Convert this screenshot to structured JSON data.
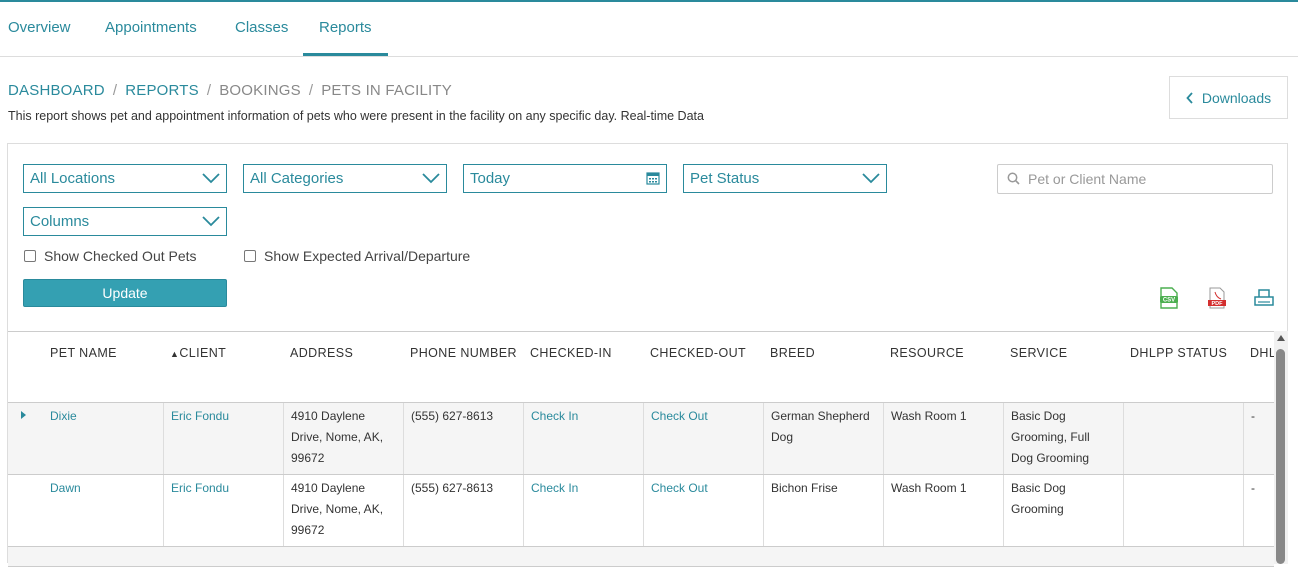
{
  "tabs": [
    {
      "label": "Overview"
    },
    {
      "label": "Appointments"
    },
    {
      "label": "Classes"
    },
    {
      "label": "Reports"
    }
  ],
  "breadcrumb": {
    "items": [
      "DASHBOARD",
      "REPORTS",
      "BOOKINGS",
      "PETS IN FACILITY"
    ],
    "separator": "/"
  },
  "description": "This report shows pet and appointment information of pets who were present in the facility on any specific day. Real-time Data",
  "downloads_label": "Downloads",
  "filters": {
    "locations": "All Locations",
    "categories": "All Categories",
    "date": "Today",
    "pet_status": "Pet Status",
    "columns": "Columns",
    "search_placeholder": "Pet or Client Name",
    "show_checked_out": "Show Checked Out Pets",
    "show_expected": "Show Expected Arrival/Departure",
    "update_label": "Update"
  },
  "export_icons": [
    "csv-icon",
    "pdf-icon",
    "print-icon"
  ],
  "export_labels": {
    "csv": "CSV",
    "pdf": "PDF"
  },
  "table": {
    "columns": [
      "PET NAME",
      "CLIENT",
      "ADDRESS",
      "PHONE NUMBER",
      "CHECKED-IN",
      "CHECKED-OUT",
      "BREED",
      "RESOURCE",
      "SERVICE",
      "DHLPP STATUS",
      "DHL"
    ],
    "sort_indicator": "▲",
    "rows": [
      {
        "pet": "Dixie",
        "client": "Eric Fondu",
        "address": [
          "4910 Daylene",
          "Drive, Nome, AK,",
          "99672"
        ],
        "phone": "(555) 627-8613",
        "checked_in": "Check In",
        "checked_out": "Check Out",
        "breed": [
          "German Shepherd",
          "Dog"
        ],
        "resource": "Wash Room 1",
        "service": [
          "Basic Dog",
          "Grooming, Full",
          "Dog Grooming"
        ],
        "dhlpp": "",
        "dhl": "-"
      },
      {
        "pet": "Dawn",
        "client": "Eric Fondu",
        "address": [
          "4910 Daylene",
          "Drive, Nome, AK,",
          "99672"
        ],
        "phone": "(555) 627-8613",
        "checked_in": "Check In",
        "checked_out": "Check Out",
        "breed": [
          "Bichon Frise"
        ],
        "resource": "Wash Room 1",
        "service": [
          "Basic Dog",
          "Grooming"
        ],
        "dhlpp": "",
        "dhl": "-"
      }
    ]
  },
  "colors": {
    "accent": "#2a8a9c",
    "button": "#34a0b2",
    "csv": "#4caf50",
    "pdf": "#d32f2f"
  }
}
